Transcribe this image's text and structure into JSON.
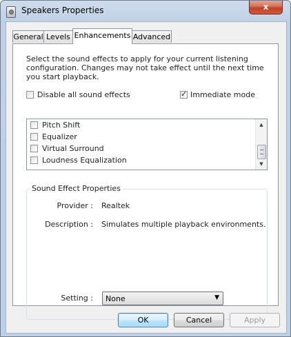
{
  "window": {
    "title": "Speakers Properties",
    "close_label": "x"
  },
  "tabs": [
    {
      "label": "General",
      "active": false
    },
    {
      "label": "Levels",
      "active": false
    },
    {
      "label": "Enhancements",
      "active": true
    },
    {
      "label": "Advanced",
      "active": false
    }
  ],
  "enhancements": {
    "description": "Select the sound effects to apply for your current listening configuration. Changes may not take effect until the next time you start playback.",
    "disable_all": {
      "label": "Disable all sound effects",
      "checked": false
    },
    "immediate_mode": {
      "label": "Immediate mode",
      "checked": true
    },
    "effects": [
      {
        "label": "Pitch Shift",
        "checked": false
      },
      {
        "label": "Equalizer",
        "checked": false
      },
      {
        "label": "Virtual Surround",
        "checked": false
      },
      {
        "label": "Loudness Equalization",
        "checked": false
      }
    ],
    "scroll_up_icon": "▲",
    "scroll_down_icon": "▼"
  },
  "sound_effect_properties": {
    "title": "Sound Effect Properties",
    "provider_label": "Provider :",
    "provider_value": "Realtek",
    "description_label": "Description :",
    "description_value": "Simulates multiple playback environments.",
    "setting_label": "Setting :",
    "setting_value": "None",
    "dropdown_icon": "▼"
  },
  "buttons": {
    "ok": "OK",
    "cancel": "Cancel",
    "apply": "Apply"
  }
}
